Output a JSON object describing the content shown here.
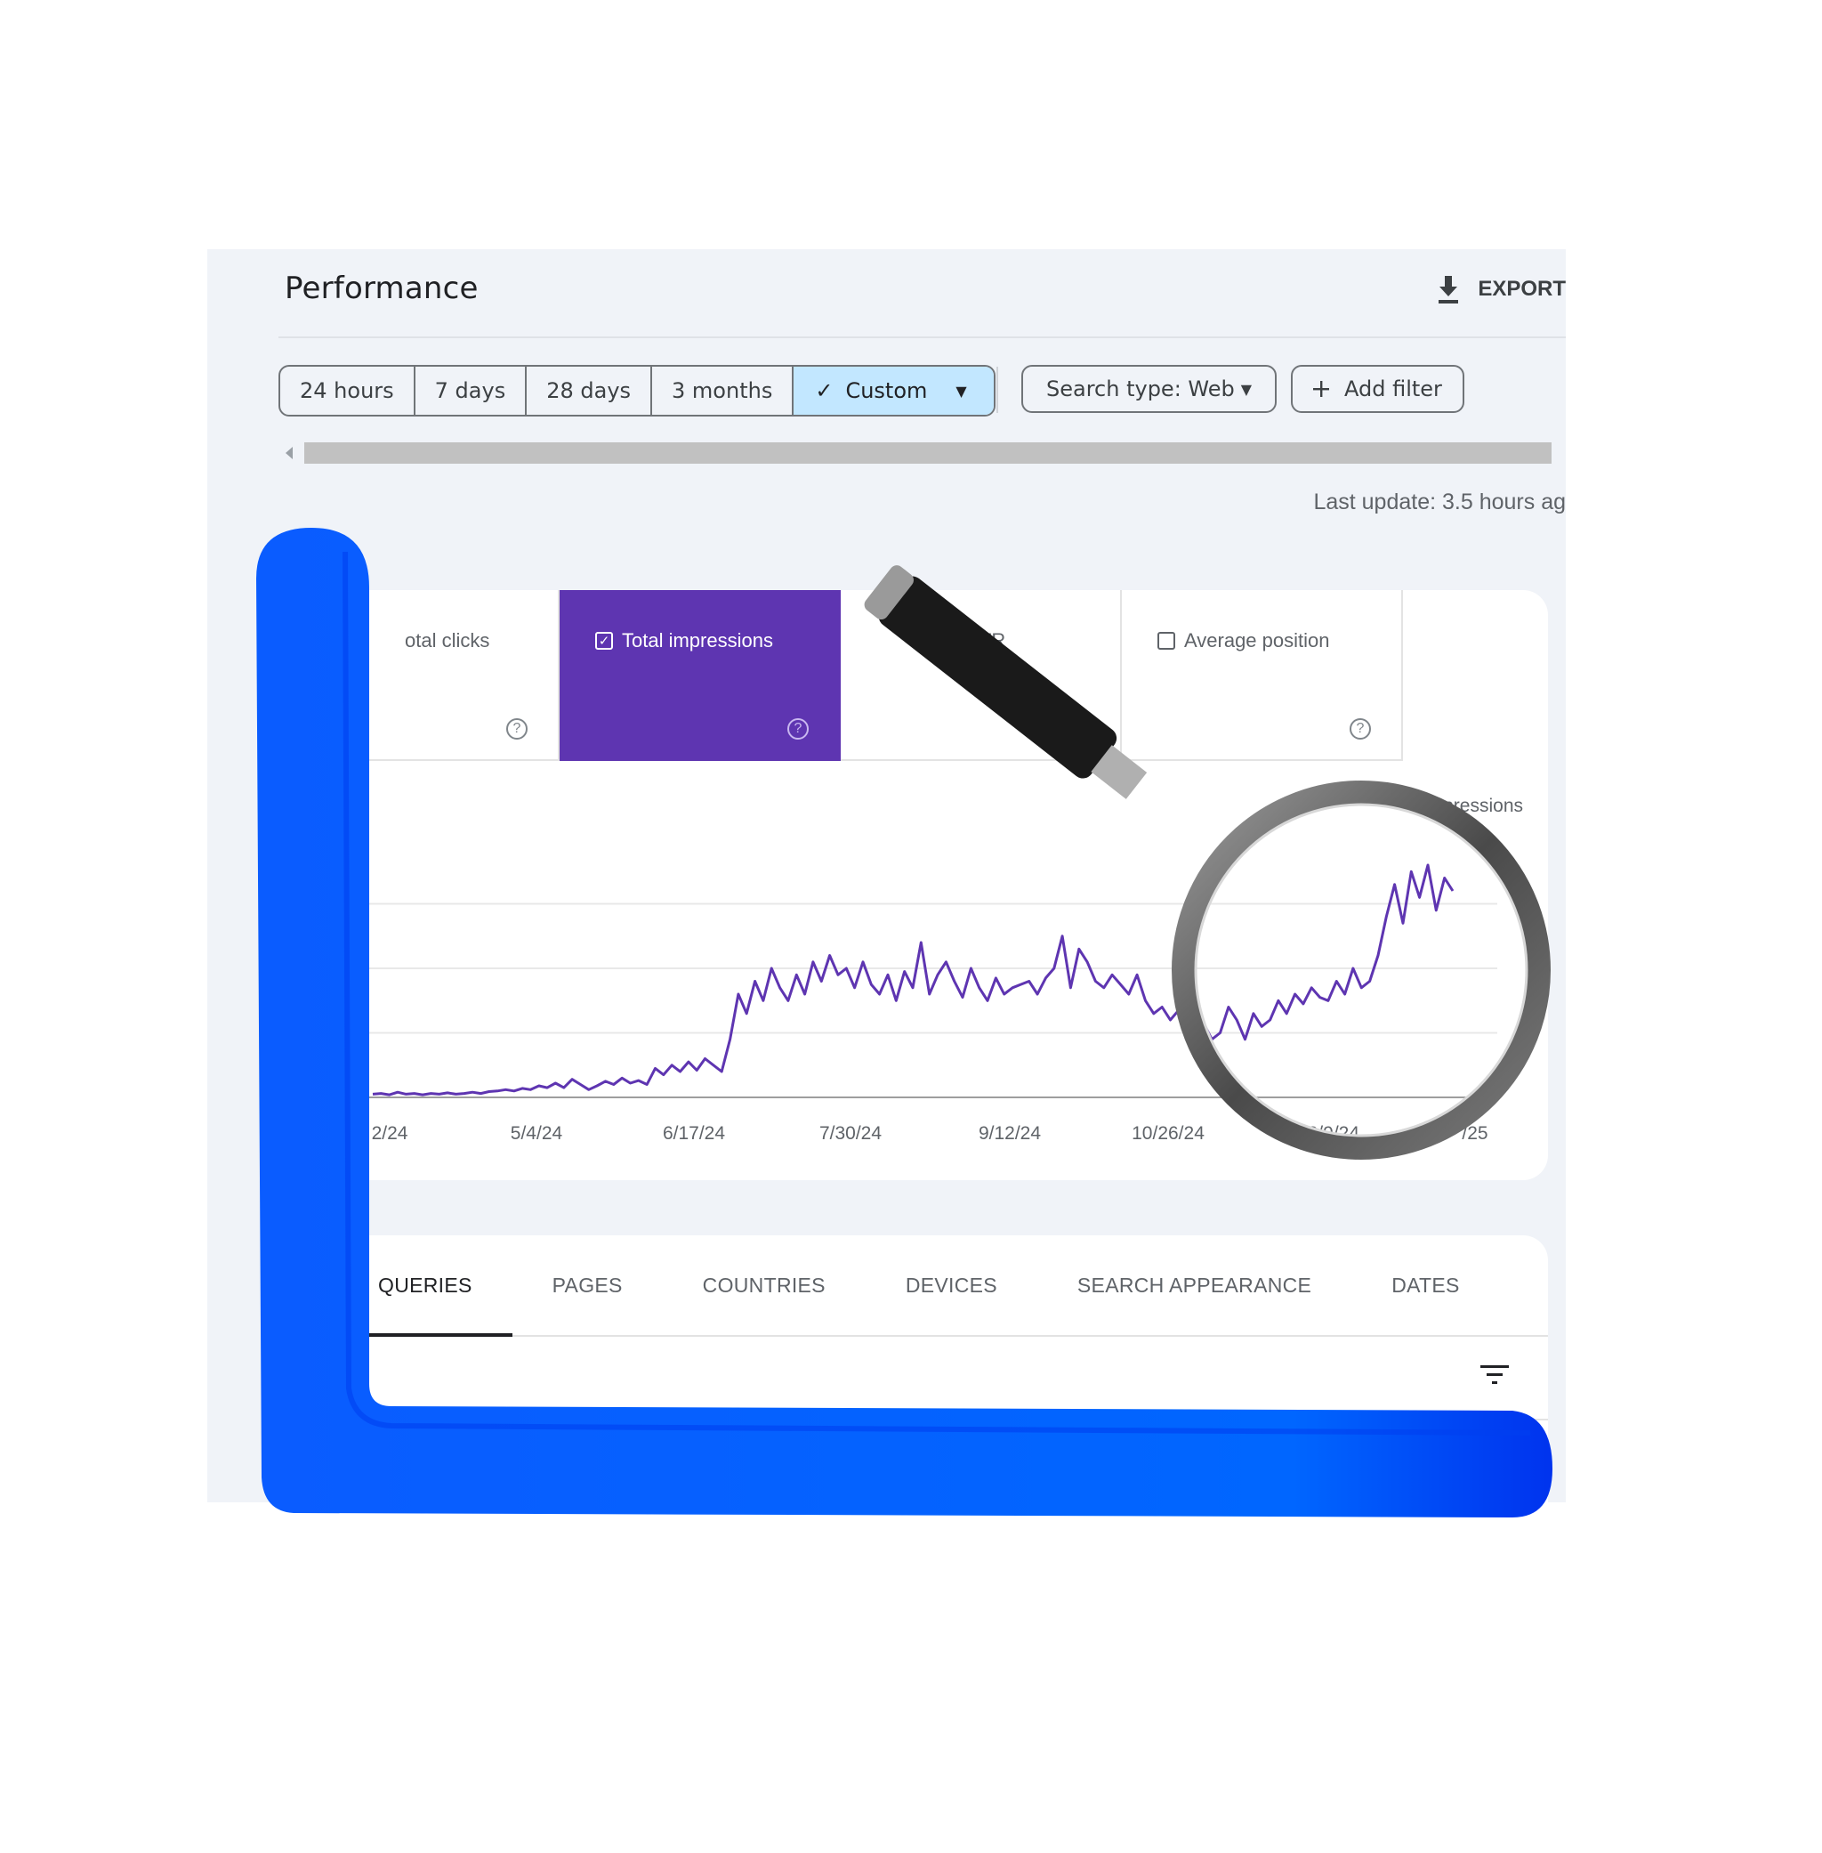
{
  "page": {
    "title": "Performance",
    "export_label": "EXPORT"
  },
  "date_range": {
    "chips": [
      "24 hours",
      "7 days",
      "28 days",
      "3 months"
    ],
    "custom_label": "Custom",
    "selected": "Custom"
  },
  "filters": {
    "search_type": "Search type: Web",
    "add_filter": "Add filter"
  },
  "status": {
    "last_update": "Last update: 3.5 hours ag"
  },
  "metrics": [
    {
      "label": "otal clicks",
      "checked": false
    },
    {
      "label": "Total impressions",
      "checked": true
    },
    {
      "label": "CTR",
      "checked": false
    },
    {
      "label": "Average position",
      "checked": false
    }
  ],
  "colors": {
    "accent": "#5e35b1",
    "overlay_blue": "#0066ff",
    "panel_bg": "#f0f3f8",
    "chip_active": "#c2e7ff"
  },
  "chart_data": {
    "type": "line",
    "title": "",
    "ylabel": "Impressions",
    "xlabel": "",
    "x_tick_labels": [
      "2/24",
      "5/4/24",
      "6/17/24",
      "7/30/24",
      "9/12/24",
      "10/26/24",
      "12/9/24",
      "/25"
    ],
    "grid": true,
    "ylim": [
      0,
      4
    ],
    "series": [
      {
        "name": "Total impressions",
        "values": [
          0.05,
          0.06,
          0.04,
          0.08,
          0.05,
          0.06,
          0.04,
          0.06,
          0.05,
          0.07,
          0.05,
          0.06,
          0.08,
          0.06,
          0.09,
          0.1,
          0.12,
          0.1,
          0.14,
          0.12,
          0.18,
          0.15,
          0.22,
          0.15,
          0.28,
          0.2,
          0.12,
          0.18,
          0.25,
          0.2,
          0.3,
          0.22,
          0.26,
          0.2,
          0.45,
          0.35,
          0.5,
          0.4,
          0.55,
          0.42,
          0.6,
          0.5,
          0.4,
          0.9,
          1.6,
          1.3,
          1.8,
          1.5,
          2.0,
          1.7,
          1.5,
          1.9,
          1.6,
          2.1,
          1.8,
          2.2,
          1.9,
          2.0,
          1.7,
          2.1,
          1.75,
          1.6,
          1.9,
          1.5,
          1.95,
          1.7,
          2.4,
          1.6,
          1.9,
          2.1,
          1.8,
          1.55,
          2.0,
          1.7,
          1.5,
          1.85,
          1.6,
          1.7,
          1.75,
          1.8,
          1.6,
          1.85,
          2.0,
          2.5,
          1.7,
          2.3,
          2.1,
          1.8,
          1.7,
          1.9,
          1.75,
          1.6,
          1.9,
          1.5,
          1.3,
          1.4,
          1.2,
          1.35,
          1.1,
          1.0,
          1.15,
          0.9,
          1.0,
          1.4,
          1.2,
          0.9,
          1.3,
          1.1,
          1.2,
          1.5,
          1.3,
          1.6,
          1.45,
          1.7,
          1.55,
          1.5,
          1.8,
          1.6,
          2.0,
          1.7,
          1.8,
          2.2,
          2.8,
          3.3,
          2.7,
          3.5,
          3.1,
          3.6,
          2.9,
          3.4,
          3.2
        ]
      }
    ]
  },
  "tabs": {
    "items": [
      "QUERIES",
      "PAGES",
      "COUNTRIES",
      "DEVICES",
      "SEARCH APPEARANCE",
      "DATES"
    ],
    "active": "QUERIES"
  }
}
